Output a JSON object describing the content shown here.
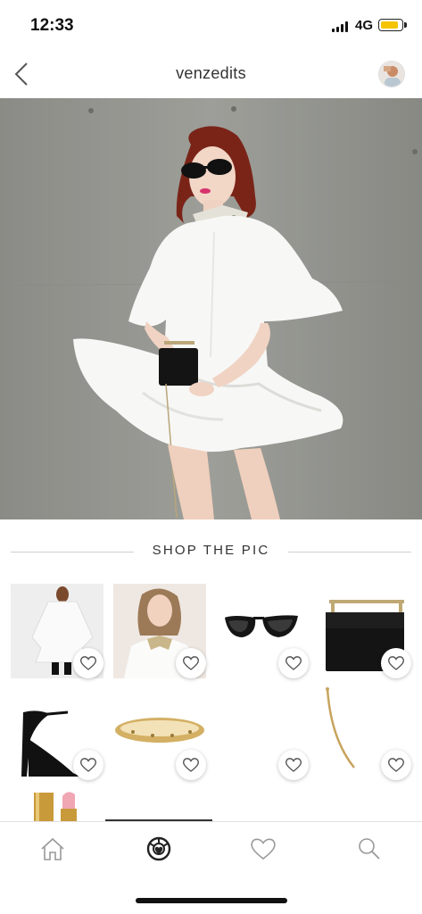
{
  "status_bar": {
    "time": "12:33",
    "network": "4G",
    "battery_color": "#f5c400",
    "battery_level": 0.9
  },
  "header": {
    "title": "venzedits",
    "back_icon": "chevron-left-icon",
    "avatar_icon": "profile-avatar"
  },
  "section": {
    "title": "SHOP THE PIC"
  },
  "products": [
    {
      "name": "white-ruffle-dress",
      "favorite_icon": "heart-outline-icon"
    },
    {
      "name": "embellished-collar-top",
      "favorite_icon": "heart-outline-icon"
    },
    {
      "name": "black-cat-eye-sunglasses",
      "favorite_icon": "heart-outline-icon"
    },
    {
      "name": "black-mini-handbag",
      "favorite_icon": "heart-outline-icon"
    },
    {
      "name": "black-strappy-sandals",
      "favorite_icon": "heart-outline-icon"
    },
    {
      "name": "gold-love-bracelet",
      "favorite_icon": "heart-outline-icon"
    },
    {
      "name": "product-no-image",
      "favorite_icon": "heart-outline-icon"
    },
    {
      "name": "gold-bar-earring",
      "favorite_icon": "heart-outline-icon"
    },
    {
      "name": "pink-lipstick",
      "favorite_icon": ""
    }
  ],
  "bottom_nav": {
    "items": [
      "home-icon",
      "shop-camera-icon",
      "heart-icon",
      "search-icon"
    ],
    "active": "shop-camera-icon"
  },
  "colors": {
    "text_dark": "#333333",
    "divider": "#cfcfcf"
  }
}
